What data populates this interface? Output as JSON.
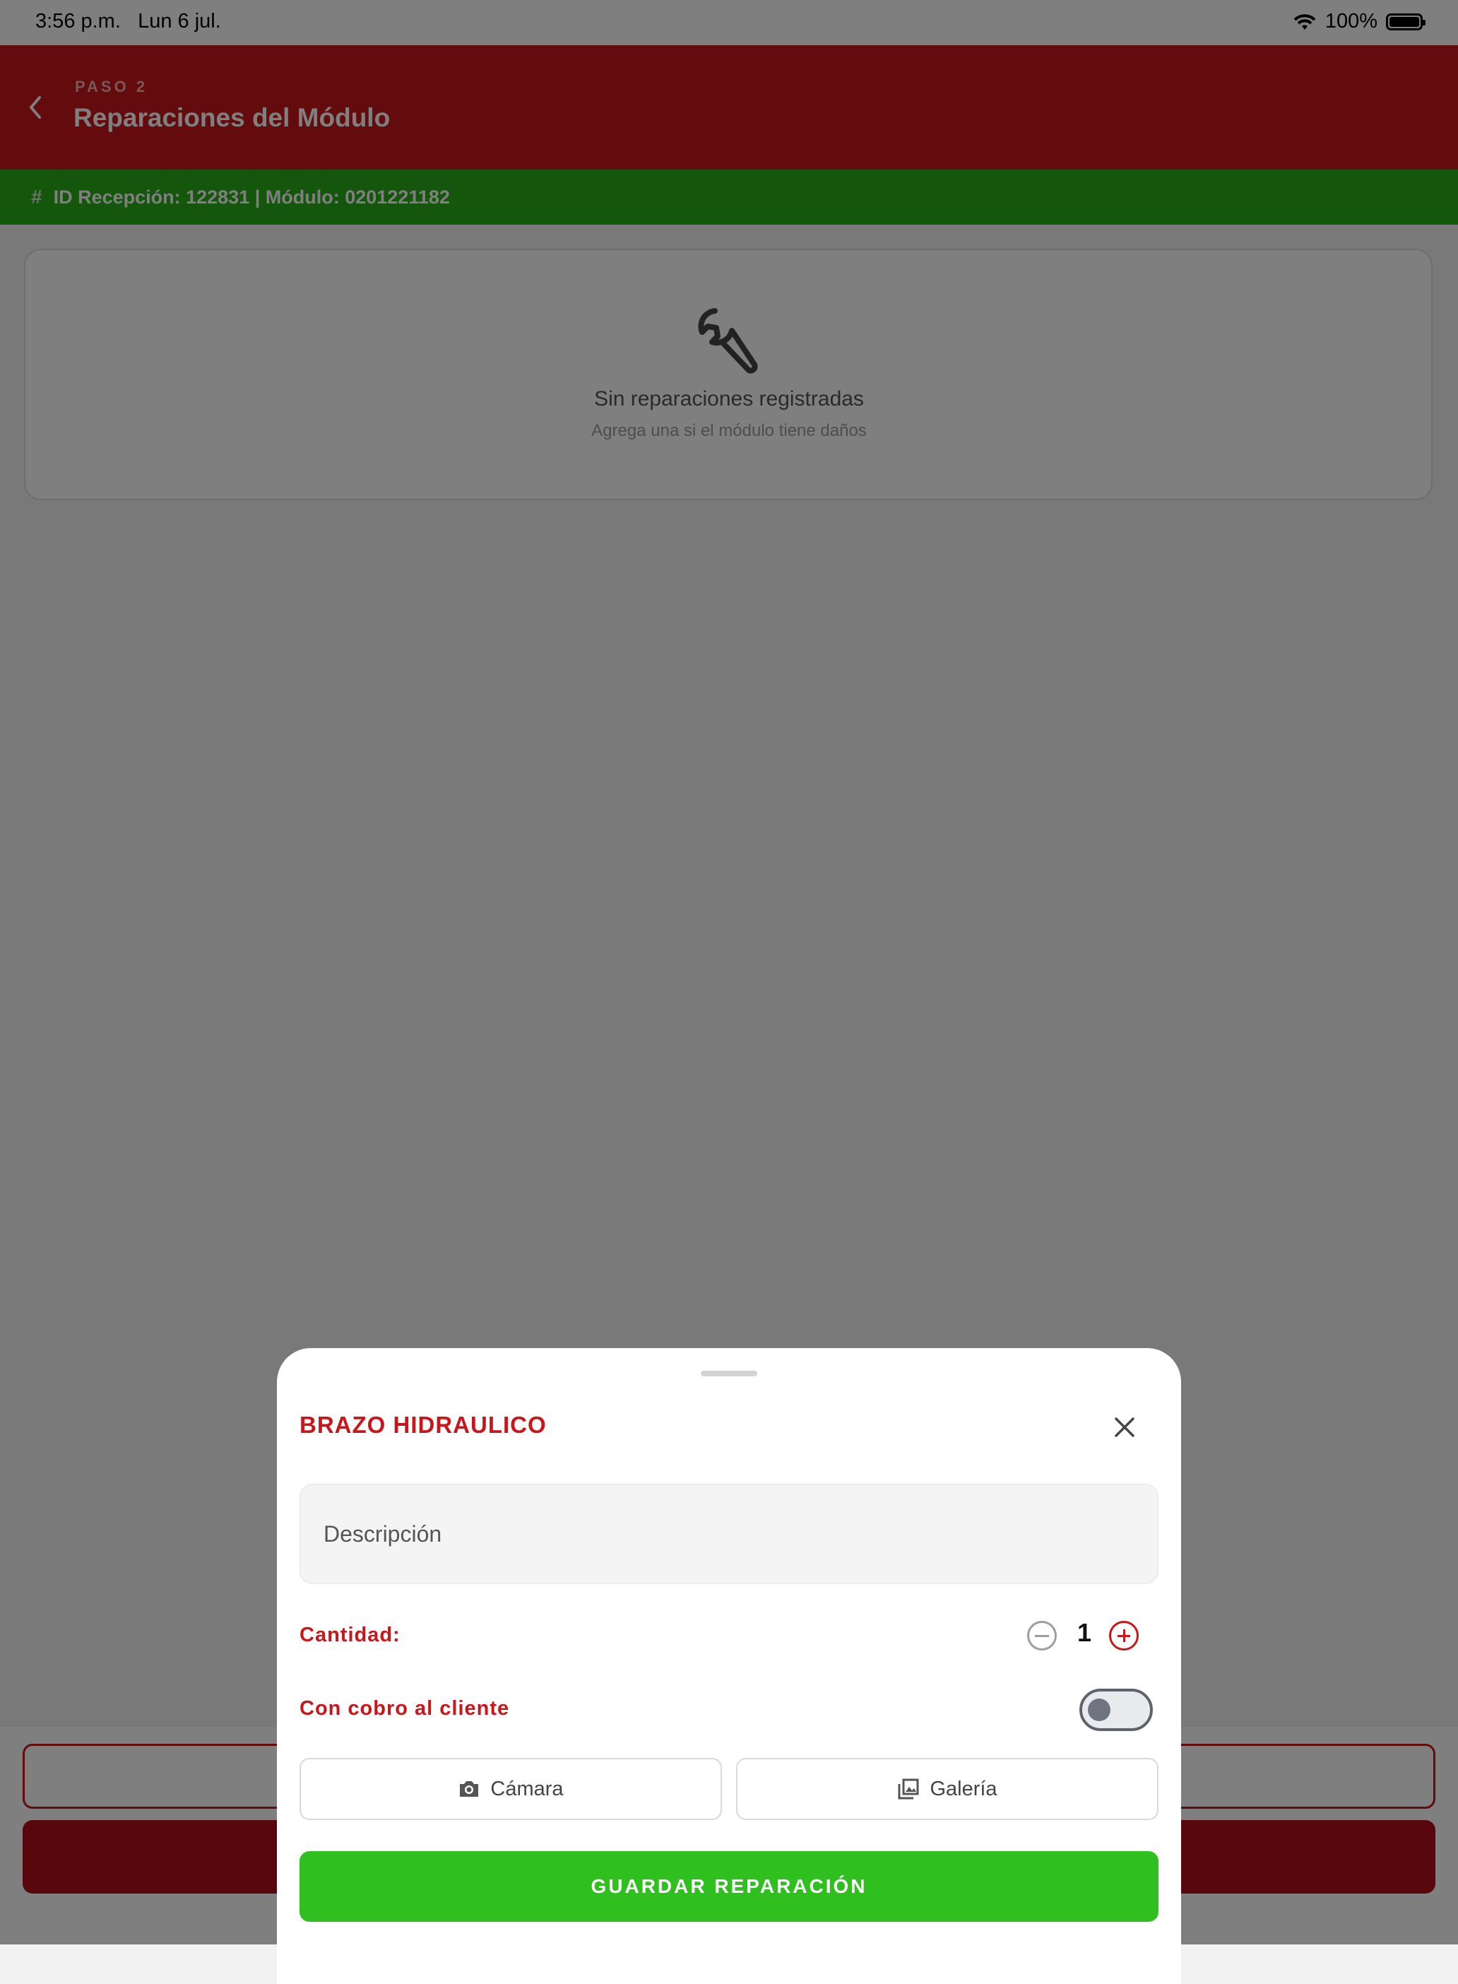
{
  "status_bar": {
    "time": "3:56 p.m.",
    "date": "Lun 6 jul.",
    "battery": "100%"
  },
  "header": {
    "step": "PASO 2",
    "title": "Reparaciones del Módulo",
    "color": "#c8161b"
  },
  "info_bar": {
    "icon": "hash-icon",
    "text": "ID Recepción: 122831  |  Módulo: 0201221182",
    "color": "#2bad1b"
  },
  "empty_state": {
    "icon": "wrench-icon",
    "title": "Sin reparaciones registradas",
    "subtitle": "Agrega una si el módulo tiene daños"
  },
  "sheet": {
    "title": "BRAZO HIDRAULICO",
    "description_placeholder": "Descripción",
    "description_value": "",
    "quantity_label": "Cantidad:",
    "quantity_value": "1",
    "charge_label": "Con cobro al cliente",
    "charge_enabled": false,
    "camera_label": "Cámara",
    "gallery_label": "Galería",
    "save_label": "GUARDAR REPARACIÓN",
    "save_color": "#2fbf1f"
  }
}
